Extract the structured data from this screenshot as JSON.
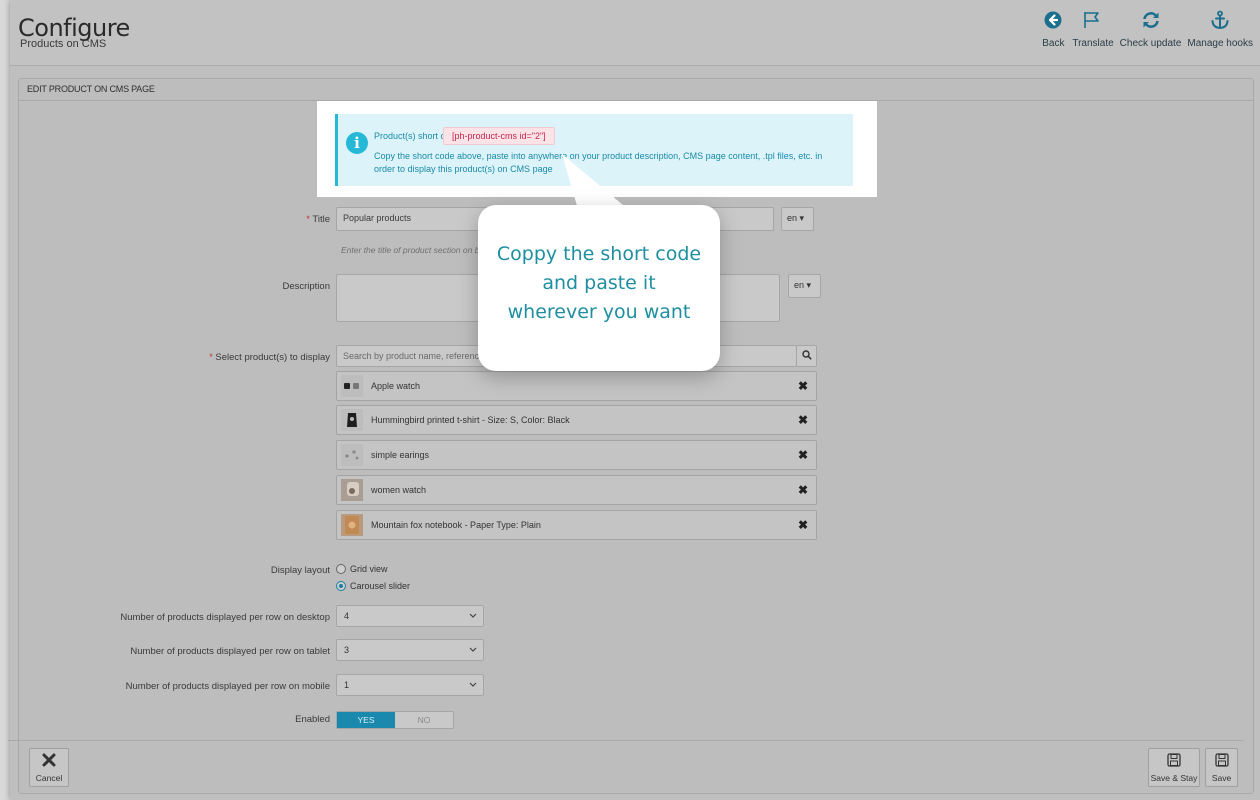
{
  "header": {
    "title": "Configure",
    "subtitle": "Products on CMS"
  },
  "toolbar": {
    "back": "Back",
    "translate": "Translate",
    "check_update": "Check update",
    "manage_hooks": "Manage hooks"
  },
  "panel": {
    "heading": "EDIT PRODUCT ON CMS PAGE"
  },
  "info": {
    "label": "Product(s) short code:",
    "shortcode": "[ph-product-cms id=\"2\"]",
    "text": "Copy the short code above, paste into anywhere on your product description, CMS page content, .tpl files, etc. in order to display this product(s) on CMS page"
  },
  "form": {
    "title_label": "Title",
    "title_value": "Popular products",
    "title_lang": "en",
    "title_help": "Enter the title of product section on b",
    "description_label": "Description",
    "description_lang": "en",
    "select_label": "Select product(s) to display",
    "search_placeholder": "Search by product name, reference",
    "products": [
      "Apple watch",
      "Hummingbird printed t-shirt - Size: S, Color: Black",
      "simple earings",
      "women watch",
      "Mountain fox notebook - Paper Type: Plain"
    ],
    "layout_label": "Display layout",
    "layout_options": [
      "Grid view",
      "Carousel slider"
    ],
    "layout_selected": "Carousel slider",
    "desktop_label": "Number of products displayed per row on desktop",
    "desktop_value": "4",
    "tablet_label": "Number of products displayed per row on tablet",
    "tablet_value": "3",
    "mobile_label": "Number of products displayed per row on mobile",
    "mobile_value": "1",
    "enabled_label": "Enabled",
    "enabled_yes": "YES",
    "enabled_no": "NO",
    "enabled_value": true
  },
  "footer": {
    "cancel": "Cancel",
    "save_stay": "Save & Stay",
    "save": "Save"
  },
  "callout": {
    "line1": "Coppy the short code",
    "line2": "and paste it",
    "line3": "wherever you want"
  },
  "colors": {
    "accent": "#25b9d7",
    "link": "#1a8aa7",
    "shortcode_text": "#c7254e",
    "switch_on": "#1b89ad"
  }
}
